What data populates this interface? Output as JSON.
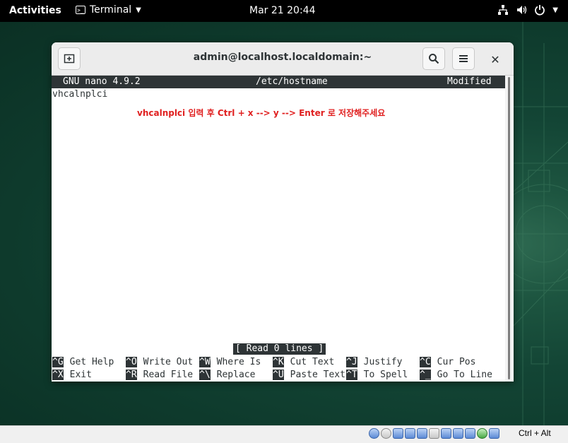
{
  "topbar": {
    "activities": "Activities",
    "app_menu": "Terminal",
    "clock": "Mar 21  20:44",
    "tray": {
      "network_icon": "network-icon",
      "volume_icon": "volume-icon",
      "power_icon": "power-icon"
    }
  },
  "window": {
    "title": "admin@localhost.localdomain:~",
    "new_tab_icon": "new-tab-icon",
    "search_icon": "search-icon",
    "menu_icon": "hamburger-menu-icon",
    "close_glyph": "✕"
  },
  "nano": {
    "version": "GNU nano 4.9.2",
    "filename": "/etc/hostname",
    "state": "Modified",
    "content_line": "vhcalnplci",
    "annotation": "vhcalnplci 입력 후 Ctrl + x --> y --> Enter 로 저장해주세요",
    "status": "[ Read 0 lines ]",
    "shortcuts": [
      {
        "key": "^G",
        "label": "Get Help"
      },
      {
        "key": "^O",
        "label": "Write Out"
      },
      {
        "key": "^W",
        "label": "Where Is"
      },
      {
        "key": "^K",
        "label": "Cut Text"
      },
      {
        "key": "^J",
        "label": "Justify"
      },
      {
        "key": "^C",
        "label": "Cur Pos"
      },
      {
        "key": "^X",
        "label": "Exit"
      },
      {
        "key": "^R",
        "label": "Read File"
      },
      {
        "key": "^\\",
        "label": "Replace"
      },
      {
        "key": "^U",
        "label": "Paste Text"
      },
      {
        "key": "^T",
        "label": "To Spell"
      },
      {
        "key": "^_",
        "label": "Go To Line"
      }
    ]
  },
  "vbox": {
    "host_key": "Ctrl + Alt"
  },
  "colors": {
    "annotation": "#e02020",
    "nano_bar": "#2e3436",
    "desktop": "#134535"
  }
}
